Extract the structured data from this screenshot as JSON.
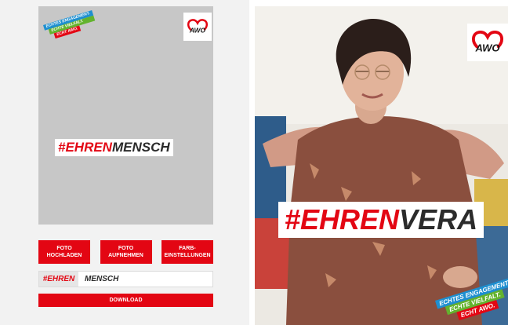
{
  "brand": {
    "red": "#e30613",
    "blue": "#1e8fd0",
    "green": "#63b32e",
    "logo_text": "AWO",
    "slogan": [
      "ECHTES ENGAGEMENT.",
      "ECHTE VIELFALT.",
      "ECHT AWO."
    ]
  },
  "editor": {
    "hashtag_prefix": "#EHREN",
    "hashtag_name": "MENSCH",
    "buttons": {
      "upload": "FOTO\nHOCHLADEN",
      "capture": "FOTO\nAUFNEHMEN",
      "colors": "FARB-\nEINSTELLUNGEN"
    },
    "name_prefix": "#EHREN",
    "name_value": "MENSCH",
    "download": "DOWNLOAD"
  },
  "preview": {
    "hashtag_prefix": "#EHREN",
    "hashtag_name": "VERA"
  }
}
